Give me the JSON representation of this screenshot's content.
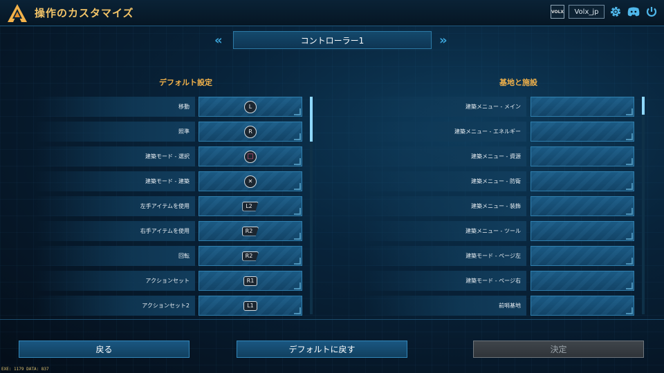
{
  "header": {
    "title": "操作のカスタマイズ",
    "badge": "VOLX",
    "username": "Volx_jp",
    "icons": [
      "settings-gear-icon",
      "discord-icon",
      "power-icon"
    ]
  },
  "controller_selector": {
    "label": "コントローラー1",
    "prev_arrow": "«",
    "next_arrow": "»"
  },
  "left_column": {
    "heading": "デフォルト設定",
    "rows": [
      {
        "label": "移動",
        "glyph": "L",
        "style": "circle"
      },
      {
        "label": "照準",
        "glyph": "R",
        "style": "circle"
      },
      {
        "label": "建築モード - 選択",
        "glyph": "□",
        "style": "circle-square"
      },
      {
        "label": "建築モード - 建築",
        "glyph": "✕",
        "style": "circle-cross"
      },
      {
        "label": "左手アイテムを使用",
        "glyph": "L2",
        "style": "trigger"
      },
      {
        "label": "右手アイテムを使用",
        "glyph": "R2",
        "style": "trigger"
      },
      {
        "label": "回転",
        "glyph": "R2",
        "style": "trigger"
      },
      {
        "label": "アクションセット",
        "glyph": "R1",
        "style": "bumper"
      },
      {
        "label": "アクションセット2",
        "glyph": "L1",
        "style": "bumper"
      }
    ]
  },
  "right_column": {
    "heading": "基地と施設",
    "rows": [
      {
        "label": "建築メニュー - メイン"
      },
      {
        "label": "建築メニュー - エネルギー"
      },
      {
        "label": "建築メニュー - 資源"
      },
      {
        "label": "建築メニュー - 防衛"
      },
      {
        "label": "建築メニュー - 装飾"
      },
      {
        "label": "建築メニュー - ツール"
      },
      {
        "label": "建築モード - ページ左"
      },
      {
        "label": "建築モード - ページ右"
      },
      {
        "label": "前哨基地"
      }
    ]
  },
  "buttons": {
    "back": "戻る",
    "reset_default": "デフォルトに戻す",
    "confirm": "決定"
  },
  "footer": {
    "version_text": "EXE: 1179 DATA: 837"
  },
  "colors": {
    "title": "#f3c468",
    "heading": "#f3b24a",
    "accent": "#3aa3d8",
    "panel": "#1b5a84"
  }
}
